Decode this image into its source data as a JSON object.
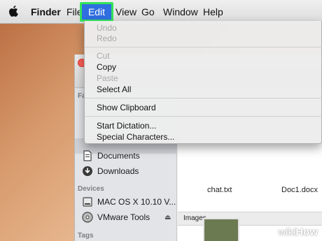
{
  "menubar": {
    "apple_icon": "apple-icon",
    "app_name": "Finder",
    "menus": [
      "File",
      "Edit",
      "View",
      "Go",
      "Window",
      "Help"
    ],
    "active_menu": "Edit",
    "highlight_color": "#35e35b"
  },
  "edit_menu": {
    "items": [
      {
        "label": "Undo",
        "enabled": false
      },
      {
        "label": "Redo",
        "enabled": false
      },
      {
        "label": "Cut",
        "enabled": false
      },
      {
        "label": "Copy",
        "enabled": true
      },
      {
        "label": "Paste",
        "enabled": false
      },
      {
        "label": "Select All",
        "enabled": true
      },
      {
        "label": "Show Clipboard",
        "enabled": true
      },
      {
        "label": "Start Dictation...",
        "enabled": true
      },
      {
        "label": "Special Characters...",
        "enabled": true
      }
    ]
  },
  "finder": {
    "sidebar": {
      "partial_heading": "Fa",
      "items": [
        {
          "label": "Documents",
          "icon": "documents-icon"
        },
        {
          "label": "Downloads",
          "icon": "downloads-icon"
        }
      ],
      "devices_heading": "Devices",
      "devices": [
        {
          "label": "MAC OS X 10.10 V...",
          "icon": "disk-icon"
        },
        {
          "label": "VMware Tools",
          "icon": "cd-icon"
        }
      ],
      "tags_heading": "Tags"
    },
    "files": [
      "chat.txt",
      "Doc1.docx"
    ],
    "section_label": "Images"
  },
  "watermark": {
    "prefix": "wiki",
    "suffix": "How"
  }
}
